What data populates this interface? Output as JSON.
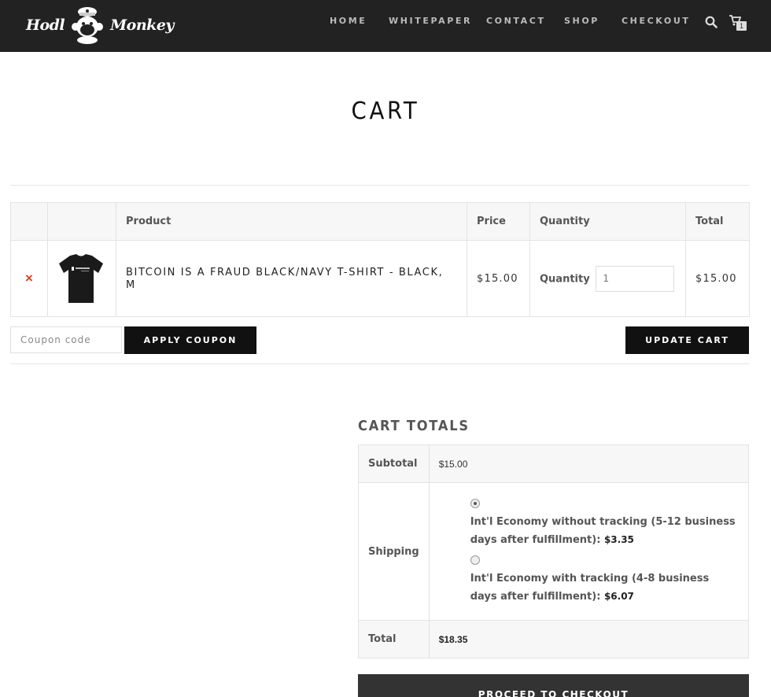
{
  "header": {
    "logo_left": "Hodl",
    "logo_right": "Monkey",
    "nav": [
      "HOME",
      "WHITEPAPER",
      "CONTACT",
      "SHOP",
      "CHECKOUT"
    ],
    "cart_count": "1"
  },
  "page": {
    "title": "CART"
  },
  "cart": {
    "columns": [
      "Product",
      "Price",
      "Quantity",
      "Total"
    ],
    "items": [
      {
        "remove": "×",
        "name": "BITCOIN IS A FRAUD BLACK/NAVY T-SHIRT - BLACK, M",
        "price": "$15.00",
        "quantity_label": "Quantity",
        "quantity": "1",
        "total": "$15.00"
      }
    ],
    "coupon_placeholder": "Coupon code",
    "apply_coupon": "APPLY COUPON",
    "update_cart": "UPDATE CART"
  },
  "totals": {
    "title": "CART TOTALS",
    "subtotal_label": "Subtotal",
    "subtotal": "$15.00",
    "shipping_label": "Shipping",
    "shipping_options": [
      {
        "text": "Int'l Economy without tracking (5-12 business days after fulfillment):",
        "amount": "$3.35",
        "selected": true
      },
      {
        "text": "Int'l Economy with tracking (4-8 business days after fulfillment):",
        "amount": "$6.07",
        "selected": false
      }
    ],
    "total_label": "Total",
    "total": "$18.35",
    "checkout_button": "PROCEED TO CHECKOUT"
  },
  "colors": {
    "header_bg": "#222222",
    "remove": "#e2401c",
    "button_dark": "#111111",
    "checkout_btn": "#333333"
  }
}
